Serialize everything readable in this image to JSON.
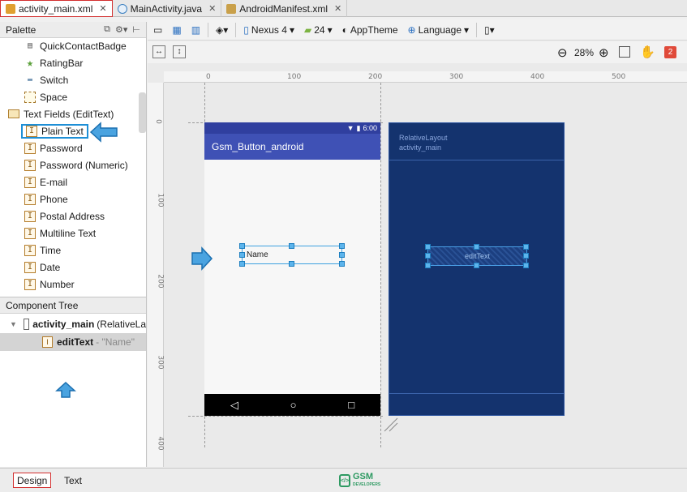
{
  "tabs": [
    {
      "label": "activity_main.xml",
      "icon": "layout-xml-icon",
      "active": true
    },
    {
      "label": "MainActivity.java",
      "icon": "java-class-icon",
      "active": false
    },
    {
      "label": "AndroidManifest.xml",
      "icon": "manifest-icon",
      "active": false
    }
  ],
  "palette": {
    "title": "Palette",
    "items": [
      "QuickContactBadge",
      "RatingBar",
      "Switch",
      "Space"
    ],
    "group": "Text Fields (EditText)",
    "fields": [
      "Plain Text",
      "Password",
      "Password (Numeric)",
      "E-mail",
      "Phone",
      "Postal Address",
      "Multiline Text",
      "Time",
      "Date",
      "Number"
    ]
  },
  "component_tree": {
    "title": "Component Tree",
    "root_name": "activity_main",
    "root_type": "(RelativeLa",
    "child_name": "editText",
    "child_value": "- \"Name\""
  },
  "toolbar": {
    "device": "Nexus 4",
    "api": "24",
    "theme": "AppTheme",
    "language": "Language",
    "zoom": "28%",
    "warnings": "2"
  },
  "rulers": {
    "h": [
      "0",
      "100",
      "200",
      "300",
      "400",
      "500"
    ],
    "v": [
      "0",
      "100",
      "200",
      "300",
      "400"
    ]
  },
  "phone": {
    "time": "6:00",
    "app_title": "Gsm_Button_android",
    "edit_hint": "Name"
  },
  "blueprint": {
    "layout_type": "RelativeLayout",
    "layout_id": "activity_main",
    "edit_label": "editText"
  },
  "bottom": {
    "design": "Design",
    "text": "Text",
    "logo": "GSM",
    "logo_sub": "DEVELOPERS"
  },
  "colors": {
    "accent_arrow": "#2c8fd6",
    "blueprint_bg": "#14336e",
    "primary": "#3f51b5"
  }
}
